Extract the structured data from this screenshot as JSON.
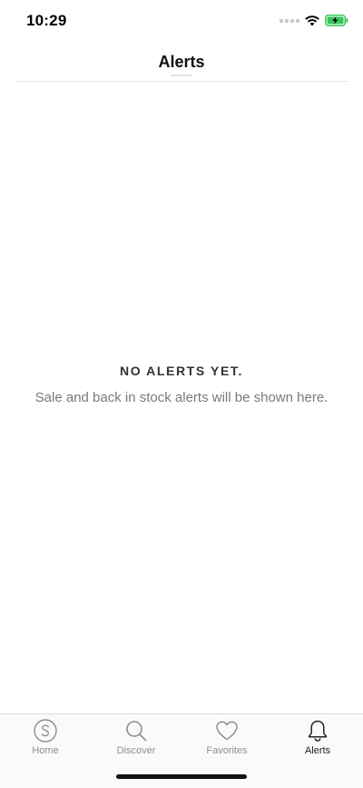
{
  "status_bar": {
    "time": "10:29"
  },
  "header": {
    "title": "Alerts"
  },
  "empty_state": {
    "title": "NO ALERTS YET.",
    "subtitle": "Sale and back in stock alerts will be shown here."
  },
  "tab_bar": {
    "items": [
      {
        "label": "Home",
        "icon": "shop-logo-icon"
      },
      {
        "label": "Discover",
        "icon": "search-icon"
      },
      {
        "label": "Favorites",
        "icon": "heart-icon"
      },
      {
        "label": "Alerts",
        "icon": "bell-icon"
      }
    ],
    "active_index": 3
  },
  "colors": {
    "battery_green": "#37c759",
    "text_muted": "#8e8e8e",
    "text_active": "#222222"
  }
}
